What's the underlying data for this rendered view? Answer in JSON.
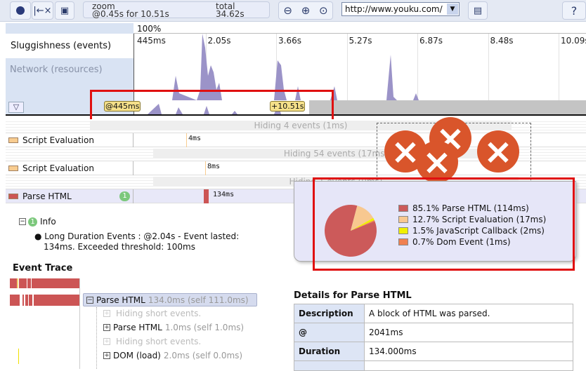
{
  "toolbar": {
    "zoom_label": "zoom",
    "zoom_value": "@0.45s for 10.51s",
    "total_label": "total",
    "total_value": "34.62s",
    "url": "http://www.youku.com/",
    "help": "?"
  },
  "timeline": {
    "zoom_percent": "100%",
    "ticks": [
      "445ms",
      "2.05s",
      "3.66s",
      "5.27s",
      "6.87s",
      "8.48s",
      "10.09s"
    ],
    "sluggishness_label": "Sluggishness (events)",
    "network_label": "Network (resources)",
    "range_start": "@445ms",
    "range_length": "+10.51s",
    "network_color": "#9b93c8"
  },
  "events": [
    {
      "type": "hidden",
      "text": "Hiding 4 events (1ms)"
    },
    {
      "type": "event",
      "label": "Script Evaluation",
      "duration": "4ms",
      "color": "#f8cc90"
    },
    {
      "type": "hidden",
      "text": "Hiding 54 events (17ms)"
    },
    {
      "type": "event",
      "label": "Script Evaluation",
      "duration": "8ms",
      "color": "#f8cc90"
    },
    {
      "type": "hidden",
      "text": "Hiding 1 events (0ms)"
    },
    {
      "type": "event",
      "label": "Parse HTML",
      "duration": "134ms",
      "color": "#cc5555",
      "badge": "1"
    }
  ],
  "pie": {
    "items": [
      {
        "label": "85.1% Parse HTML (114ms)",
        "percent": 85.1,
        "color": "#cc5a5a"
      },
      {
        "label": "12.7% Script Evaluation (17ms)",
        "percent": 12.7,
        "color": "#f8c890"
      },
      {
        "label": "1.5% JavaScript Callback (2ms)",
        "percent": 1.5,
        "color": "#f0f000"
      },
      {
        "label": "0.7% Dom Event (1ms)",
        "percent": 0.7,
        "color": "#f08050"
      }
    ]
  },
  "info": {
    "badge": "1",
    "title": "Info",
    "line1": "Long Duration Events : @2.04s - Event lasted:",
    "line2": "134ms. Exceeded threshold: 100ms"
  },
  "trace": {
    "title": "Event Trace",
    "items": [
      {
        "name": "Parse HTML",
        "time": "134.0ms (self 111.0ms)",
        "expander": "−"
      },
      {
        "name": "",
        "time": "Hiding short events.",
        "expander": "+"
      },
      {
        "name": "Parse HTML",
        "time": "1.0ms (self 1.0ms)",
        "expander": "+"
      },
      {
        "name": "",
        "time": "Hiding short events.",
        "expander": "+"
      },
      {
        "name": "DOM (load)",
        "time": "2.0ms (self 0.0ms)",
        "expander": "+"
      }
    ]
  },
  "details": {
    "title": "Details for Parse HTML",
    "rows": [
      {
        "key": "Description",
        "value": "A block of HTML was parsed."
      },
      {
        "key": "@",
        "value": "2041ms"
      },
      {
        "key": "Duration",
        "value": "134.000ms"
      }
    ]
  }
}
